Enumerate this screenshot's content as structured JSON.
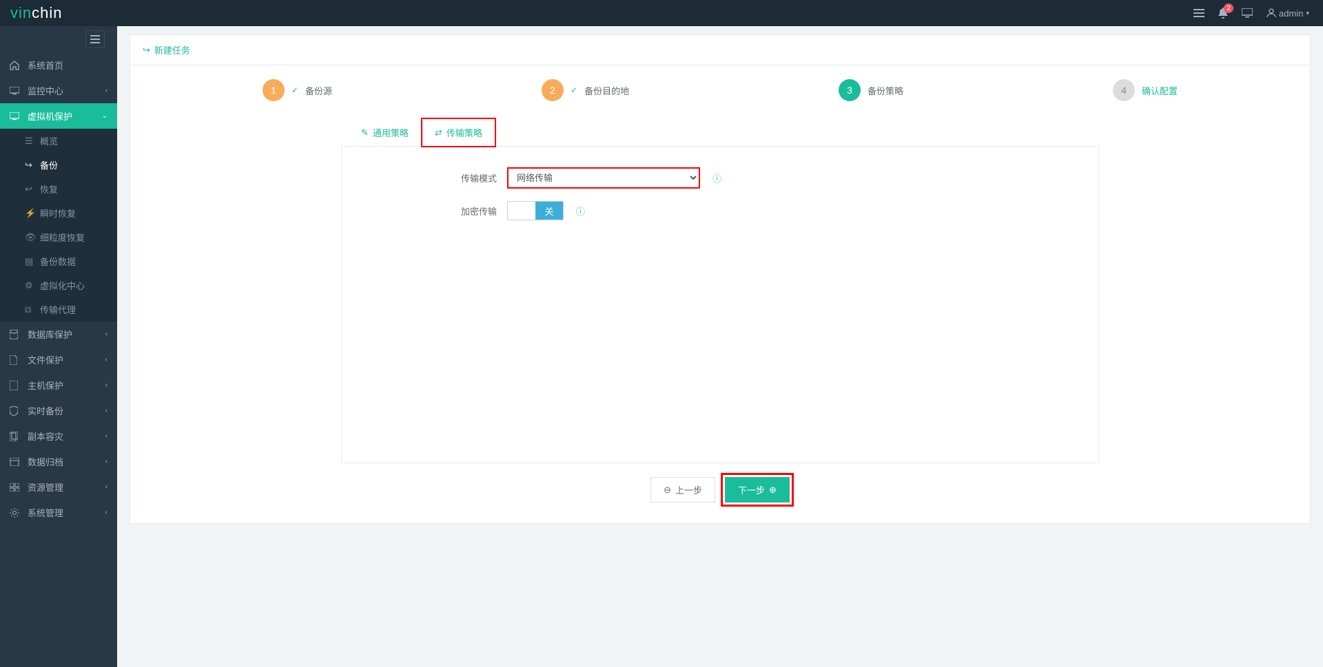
{
  "brand": {
    "part1": "vin",
    "part2": "chin"
  },
  "topbar": {
    "notif_count": "2",
    "user": "admin"
  },
  "sidebar": {
    "items": [
      {
        "label": "系统首页"
      },
      {
        "label": "监控中心"
      },
      {
        "label": "虚拟机保护"
      },
      {
        "label": "数据库保护"
      },
      {
        "label": "文件保护"
      },
      {
        "label": "主机保护"
      },
      {
        "label": "实时备份"
      },
      {
        "label": "副本容灾"
      },
      {
        "label": "数据归档"
      },
      {
        "label": "资源管理"
      },
      {
        "label": "系统管理"
      }
    ],
    "sub": [
      {
        "label": "概览"
      },
      {
        "label": "备份"
      },
      {
        "label": "恢复"
      },
      {
        "label": "瞬时恢复"
      },
      {
        "label": "细粒度恢复"
      },
      {
        "label": "备份数据"
      },
      {
        "label": "虚拟化中心"
      },
      {
        "label": "传输代理"
      }
    ]
  },
  "panel": {
    "title": "新建任务"
  },
  "steps": [
    {
      "num": "1",
      "label": "备份源"
    },
    {
      "num": "2",
      "label": "备份目的地"
    },
    {
      "num": "3",
      "label": "备份策略"
    },
    {
      "num": "4",
      "label": "确认配置"
    }
  ],
  "tabs": {
    "general": "通用策略",
    "transport": "传输策略"
  },
  "form": {
    "mode_label": "传输模式",
    "mode_value": "网络传输",
    "encrypt_label": "加密传输",
    "encrypt_value": "关"
  },
  "buttons": {
    "prev": "上一步",
    "next": "下一步"
  }
}
